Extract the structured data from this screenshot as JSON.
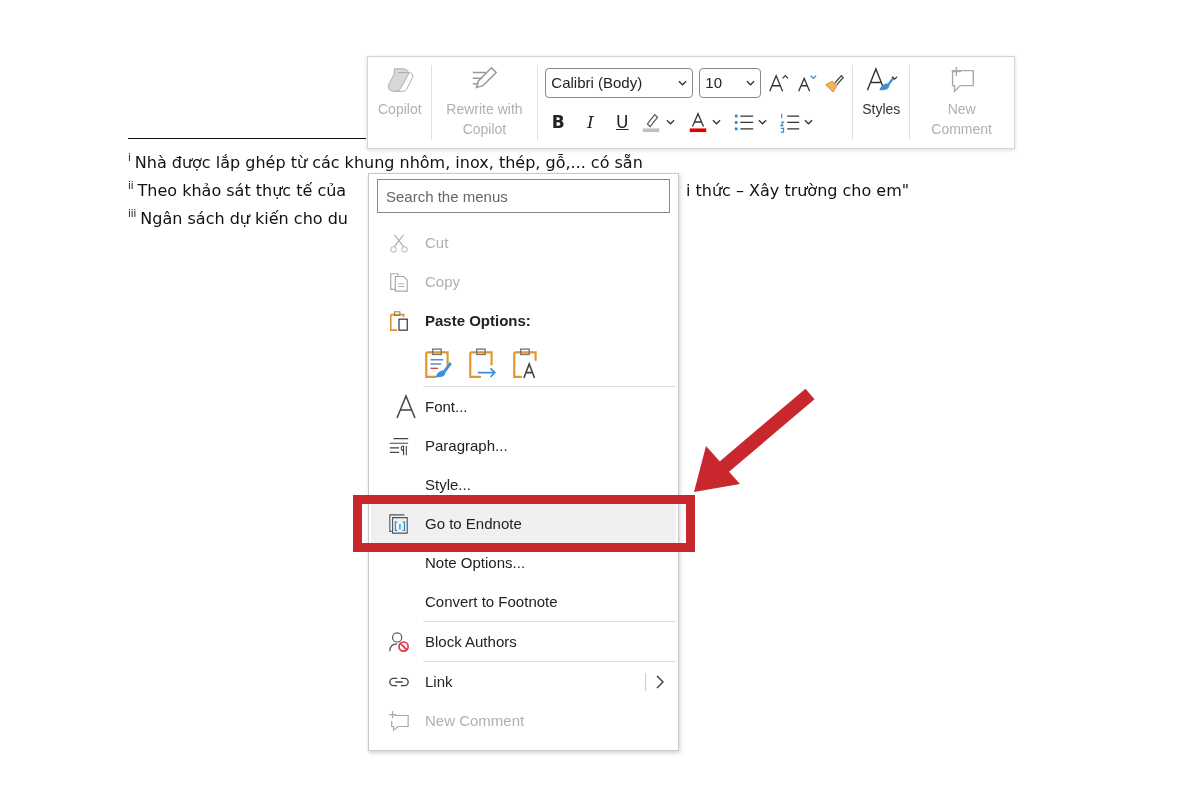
{
  "document": {
    "endnotes": [
      {
        "mark": "i",
        "segments": [
          "Nhà được lắp ghép từ các khung nhôm, inox, thép, gỗ,... có sẵn"
        ]
      },
      {
        "mark": "ii",
        "segments": [
          "Theo khảo sát thực tế của",
          "i thức – Xây trường cho em\""
        ]
      },
      {
        "mark": "iii",
        "segments": [
          "Ngân sách dự kiến cho du"
        ]
      }
    ]
  },
  "toolbar": {
    "left_buttons": [
      {
        "label": "Copilot",
        "disabled": true
      },
      {
        "label": "Rewrite with Copilot",
        "disabled": true
      }
    ],
    "font_name": "Calibri (Body)",
    "font_size": "10",
    "format_buttons": [
      "B",
      "I",
      "U"
    ],
    "right_buttons": [
      {
        "label": "Styles",
        "disabled": false
      },
      {
        "label": "New Comment",
        "disabled": true
      }
    ]
  },
  "context_menu": {
    "search": {
      "placeholder": "Search the menus"
    },
    "items": [
      {
        "kind": "item",
        "label": "Cut",
        "disabled": true,
        "selected": false
      },
      {
        "kind": "item",
        "label": "Copy",
        "disabled": true,
        "selected": false
      },
      {
        "kind": "header",
        "label": "Paste Options:"
      },
      {
        "kind": "paste-options"
      },
      {
        "kind": "separator"
      },
      {
        "kind": "item",
        "label": "Font...",
        "disabled": false,
        "selected": false
      },
      {
        "kind": "item",
        "label": "Paragraph...",
        "disabled": false,
        "selected": false
      },
      {
        "kind": "item",
        "label": "Style...",
        "disabled": false,
        "selected": false
      },
      {
        "kind": "item",
        "label": "Go to Endnote",
        "disabled": false,
        "selected": true
      },
      {
        "kind": "item",
        "label": "Note Options...",
        "disabled": false,
        "selected": false
      },
      {
        "kind": "item",
        "label": "Convert to Footnote",
        "disabled": false,
        "selected": false
      },
      {
        "kind": "separator"
      },
      {
        "kind": "item",
        "label": "Block Authors",
        "disabled": false,
        "selected": false
      },
      {
        "kind": "separator"
      },
      {
        "kind": "submenu",
        "label": "Link",
        "disabled": false,
        "selected": false
      },
      {
        "kind": "item",
        "label": "New Comment",
        "disabled": true,
        "selected": false
      }
    ]
  }
}
